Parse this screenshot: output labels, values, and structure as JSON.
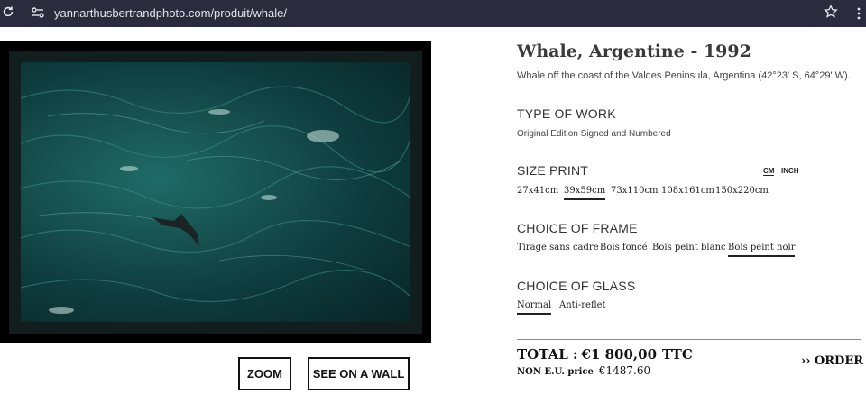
{
  "browser": {
    "url": "yannarthusbertrandphoto.com/produit/whale/"
  },
  "product": {
    "title": "Whale, Argentine - 1992",
    "description": "Whale off the coast of the Valdes Peninsula, Argentina (42°23' S, 64°29' W)."
  },
  "type_of_work": {
    "heading": "TYPE OF WORK",
    "value": "Original Edition Signed and Numbered"
  },
  "size_print": {
    "heading": "SIZE PRINT",
    "units": [
      "CM",
      "INCH"
    ],
    "selected_unit": "CM",
    "options": [
      "27x41cm",
      "39x59cm",
      "73x110cm",
      "108x161cm",
      "150x220cm"
    ],
    "selected": "39x59cm"
  },
  "frame_choice": {
    "heading": "CHOICE OF FRAME",
    "options": [
      "Tirage sans cadre",
      "Bois foncé",
      "Bois peint blanc",
      "Bois peint noir"
    ],
    "selected": "Bois peint noir"
  },
  "glass_choice": {
    "heading": "CHOICE OF GLASS",
    "options": [
      "Normal",
      "Anti-reflet"
    ],
    "selected": "Normal"
  },
  "price": {
    "total_label": "TOTAL :",
    "total_amount": "€1 800,00",
    "total_suffix": "TTC",
    "non_eu_label": "NON E.U. price",
    "non_eu_amount": "€1487.60"
  },
  "actions": {
    "order": "›› ORDER",
    "zoom": "ZOOM",
    "see_on_wall": "SEE ON A WALL"
  },
  "icons": [
    "reload-icon",
    "site-info-icon",
    "star-icon",
    "menu-icon"
  ],
  "colors": {
    "browser_bar": "#2b2b3d",
    "photo_ocean": "#164f4e",
    "frame": "#000000"
  }
}
